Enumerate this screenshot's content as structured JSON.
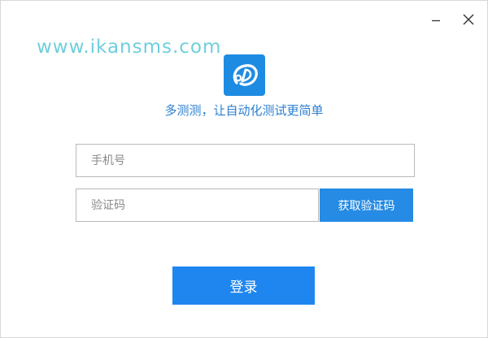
{
  "watermark": "www.ikansms.com",
  "logo": {
    "icon": "duoceshi-logo-icon",
    "brand_color": "#1e8be3"
  },
  "slogan": "多测测，让自动化测试更简单",
  "window_controls": {
    "minimize_icon": "minimize-icon",
    "close_icon": "close-icon"
  },
  "form": {
    "phone": {
      "value": "",
      "placeholder": "手机号"
    },
    "code": {
      "value": "",
      "placeholder": "验证码"
    },
    "get_code_label": "获取验证码",
    "login_label": "登录"
  },
  "colors": {
    "accent": "#268be4",
    "login_button": "#1f86f0",
    "slogan_text": "#2b7fd0",
    "watermark_text": "#57c6d8"
  }
}
